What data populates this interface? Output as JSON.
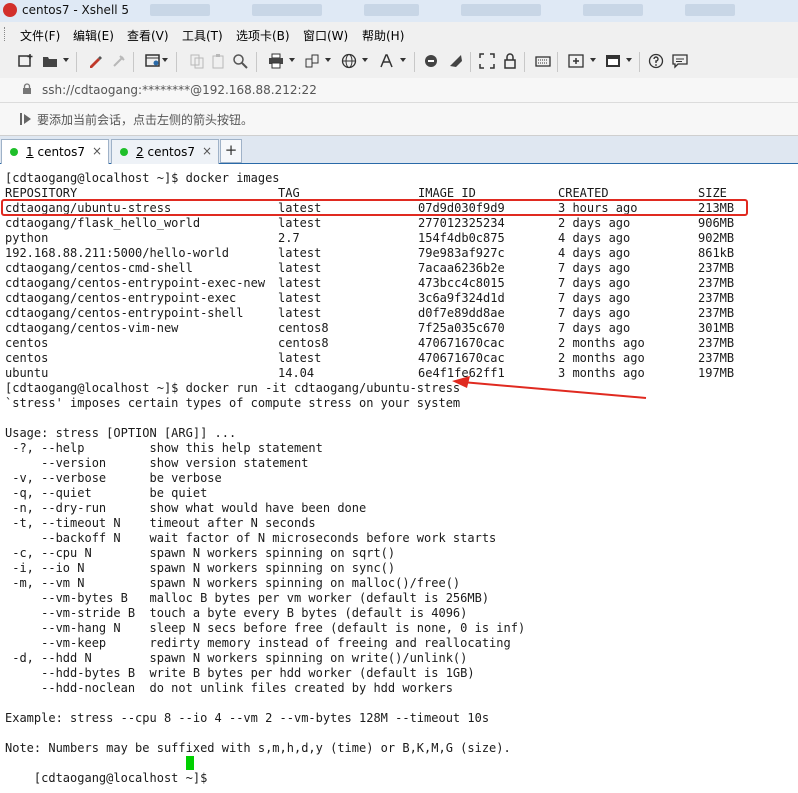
{
  "window": {
    "title": "centos7 - Xshell 5",
    "accent_color": "#d2302c"
  },
  "menu": {
    "items": [
      "文件(F)",
      "编辑(E)",
      "查看(V)",
      "工具(T)",
      "选项卡(B)",
      "窗口(W)",
      "帮助(H)"
    ]
  },
  "toolbar": {
    "icons": [
      "new-session-icon",
      "open-folder-icon",
      "properties-icon",
      "disconnect-icon",
      "new-window-icon",
      "copy-icon",
      "paste-icon",
      "find-icon",
      "print-icon",
      "transfer-icon",
      "globe-icon",
      "font-icon",
      "script-icon",
      "xftp-icon",
      "fullscreen-icon",
      "lock-icon",
      "keyboard-icon",
      "add-tab-icon",
      "layout-icon",
      "help-icon",
      "chat-icon"
    ]
  },
  "address": {
    "text": "ssh://cdtaogang:********@192.168.88.212:22"
  },
  "hint": {
    "text": "要添加当前会话，点击左侧的箭头按钮。"
  },
  "tabs": [
    {
      "number": "1",
      "name": "centos7",
      "active": true,
      "status_color": "#1fbf2a"
    },
    {
      "number": "2",
      "name": "centos7",
      "active": false,
      "status_color": "#1fbf2a"
    }
  ],
  "tab_add_label": "+",
  "tab_close_label": "×",
  "terminal": {
    "prompt1": "[cdtaogang@localhost ~]$ docker images",
    "table_headers": [
      "REPOSITORY",
      "TAG",
      "IMAGE ID",
      "CREATED",
      "SIZE"
    ],
    "images": [
      [
        "cdtaogang/ubuntu-stress",
        "latest",
        "07d9d030f9d9",
        "3 hours ago",
        "213MB"
      ],
      [
        "cdtaogang/flask_hello_world",
        "latest",
        "277012325234",
        "2 days ago",
        "906MB"
      ],
      [
        "python",
        "2.7",
        "154f4db0c875",
        "4 days ago",
        "902MB"
      ],
      [
        "192.168.88.211:5000/hello-world",
        "latest",
        "79e983af927c",
        "4 days ago",
        "861kB"
      ],
      [
        "cdtaogang/centos-cmd-shell",
        "latest",
        "7acaa6236b2e",
        "7 days ago",
        "237MB"
      ],
      [
        "cdtaogang/centos-entrypoint-exec-new",
        "latest",
        "473bcc4c8015",
        "7 days ago",
        "237MB"
      ],
      [
        "cdtaogang/centos-entrypoint-exec",
        "latest",
        "3c6a9f324d1d",
        "7 days ago",
        "237MB"
      ],
      [
        "cdtaogang/centos-entrypoint-shell",
        "latest",
        "d0f7e89dd8ae",
        "7 days ago",
        "237MB"
      ],
      [
        "cdtaogang/centos-vim-new",
        "centos8",
        "7f25a035c670",
        "7 days ago",
        "301MB"
      ],
      [
        "centos",
        "centos8",
        "470671670cac",
        "2 months ago",
        "237MB"
      ],
      [
        "centos",
        "latest",
        "470671670cac",
        "2 months ago",
        "237MB"
      ],
      [
        "ubuntu",
        "14.04",
        "6e4f1fe62ff1",
        "3 months ago",
        "197MB"
      ]
    ],
    "prompt2": "[cdtaogang@localhost ~]$ docker run -it cdtaogang/ubuntu-stress",
    "output_lines": [
      "`stress' imposes certain types of compute stress on your system",
      "",
      "Usage: stress [OPTION [ARG]] ...",
      " -?, --help         show this help statement",
      "     --version      show version statement",
      " -v, --verbose      be verbose",
      " -q, --quiet        be quiet",
      " -n, --dry-run      show what would have been done",
      " -t, --timeout N    timeout after N seconds",
      "     --backoff N    wait factor of N microseconds before work starts",
      " -c, --cpu N        spawn N workers spinning on sqrt()",
      " -i, --io N         spawn N workers spinning on sync()",
      " -m, --vm N         spawn N workers spinning on malloc()/free()",
      "     --vm-bytes B   malloc B bytes per vm worker (default is 256MB)",
      "     --vm-stride B  touch a byte every B bytes (default is 4096)",
      "     --vm-hang N    sleep N secs before free (default is none, 0 is inf)",
      "     --vm-keep      redirty memory instead of freeing and reallocating",
      " -d, --hdd N        spawn N workers spinning on write()/unlink()",
      "     --hdd-bytes B  write B bytes per hdd worker (default is 1GB)",
      "     --hdd-noclean  do not unlink files created by hdd workers",
      "",
      "Example: stress --cpu 8 --io 4 --vm 2 --vm-bytes 128M --timeout 10s",
      "",
      "Note: Numbers may be suffixed with s,m,h,d,y (time) or B,K,M,G (size)."
    ],
    "prompt3": "[cdtaogang@localhost ~]$ ",
    "annotation_color": "#e02a20",
    "cursor_color": "#00d000"
  }
}
